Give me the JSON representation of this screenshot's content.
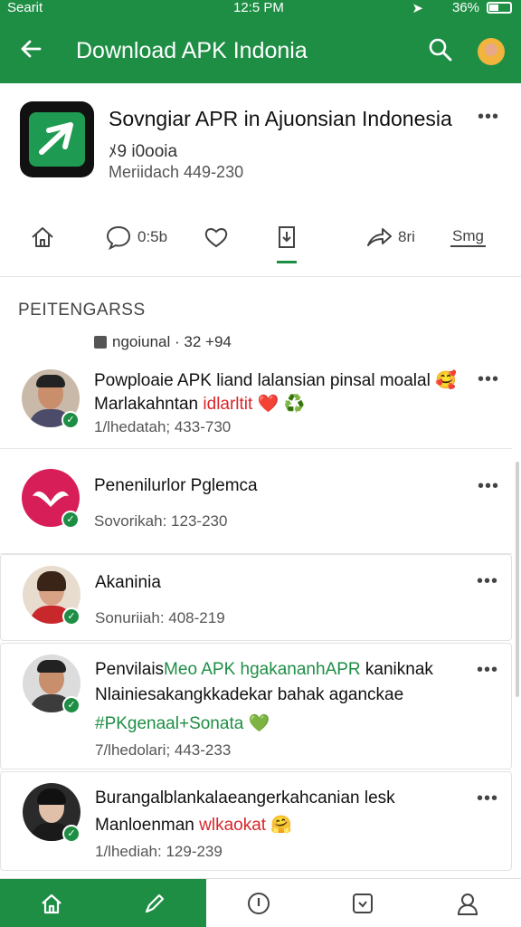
{
  "status_bar": {
    "carrier": "Searit",
    "time": "12:5 PM",
    "battery": "36%"
  },
  "app_bar": {
    "title": "Download APK Indonia",
    "icons": [
      "back-arrow-icon",
      "search-icon",
      "avatar"
    ]
  },
  "app": {
    "name": "Sovngiar APR in Ajuonsian Indonesia",
    "version": "ﾒ9 i0ooia",
    "meta": "Meriidach 449-230",
    "actions": [
      {
        "icon": "home-icon",
        "label": ""
      },
      {
        "icon": "comment-icon",
        "label": "0:5b"
      },
      {
        "icon": "heart-icon",
        "label": ""
      },
      {
        "icon": "download-icon",
        "label": ""
      },
      {
        "icon": "share-icon",
        "label": "8ri"
      },
      {
        "icon": "tag-icon",
        "label": "Smg"
      }
    ]
  },
  "section": {
    "title": "PEITENGARSS",
    "count_label": "ngoiunal · 32 +94"
  },
  "items": [
    {
      "line1": "Powploaie APK liand lalansian pinsal moalal",
      "line1_emoji": "🥰",
      "line2_prefix": "Marlakahntan",
      "line2_highlight": "idlarltit",
      "line2_suffix": "❤️ ♻️",
      "meta": "1/lhedatah; 433-730"
    },
    {
      "line1": "Penenilurlor Pglemca",
      "meta": "Sovorikah: 123-230"
    },
    {
      "line1": "Akaninia",
      "meta": "Sonuriiah: 408-219"
    },
    {
      "line1_prefix": "Penvilais",
      "line1_highlight": "Meo APK hgakananhAPR",
      "line1_suffix": "kaniknak",
      "line2": "Nlainiesakangkkadekar bahak aganckae",
      "line3_tag": "#PKgenaal+Sonata",
      "line3_emoji": "💚",
      "meta": "7/lhedolari; 443-233"
    },
    {
      "line1": "Burangalblankalaeangerkahcanian lesk",
      "line2_prefix": "Manloenman",
      "line2_highlight": "wlkaokat",
      "line2_suffix": "🤗",
      "meta": "1/lhediah: 129-239"
    }
  ],
  "colors": {
    "primary": "#1e8e45",
    "highlight_red": "#d8262a",
    "text": "#111111"
  },
  "bottom_nav": [
    {
      "icon": "home-icon"
    },
    {
      "icon": "pen-icon"
    },
    {
      "icon": "info-icon"
    },
    {
      "icon": "message-icon"
    },
    {
      "icon": "profile-icon"
    }
  ]
}
